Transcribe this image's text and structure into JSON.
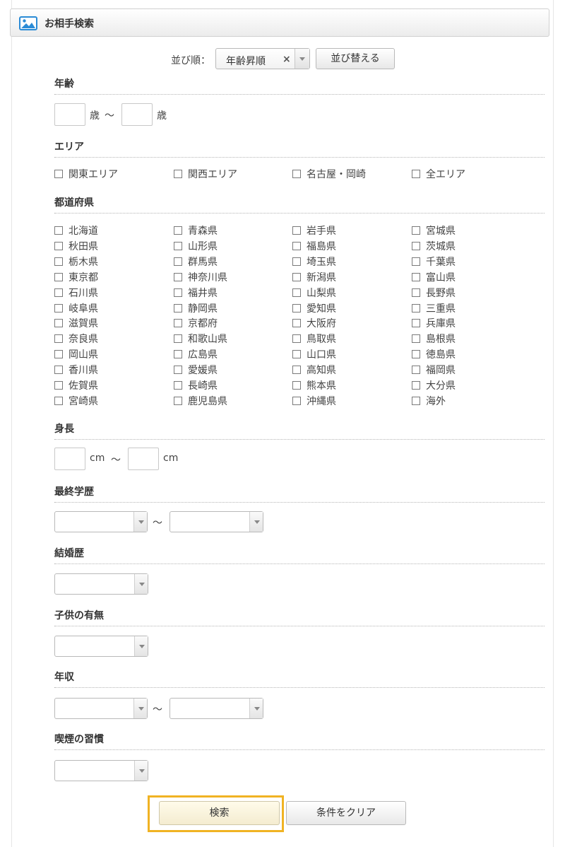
{
  "header": {
    "title": "お相手検索",
    "icon": "image-icon"
  },
  "sort": {
    "label": "並び順：",
    "selected": "年齢昇順",
    "clear": "×",
    "button": "並び替える"
  },
  "age": {
    "title": "年齢",
    "unit1": "歳",
    "tilde": "～",
    "unit2": "歳"
  },
  "area": {
    "title": "エリア",
    "items": [
      "関東エリア",
      "関西エリア",
      "名古屋・岡崎",
      "全エリア"
    ]
  },
  "prefecture": {
    "title": "都道府県",
    "items": [
      "北海道",
      "青森県",
      "岩手県",
      "宮城県",
      "秋田県",
      "山形県",
      "福島県",
      "茨城県",
      "栃木県",
      "群馬県",
      "埼玉県",
      "千葉県",
      "東京都",
      "神奈川県",
      "新潟県",
      "富山県",
      "石川県",
      "福井県",
      "山梨県",
      "長野県",
      "岐阜県",
      "静岡県",
      "愛知県",
      "三重県",
      "滋賀県",
      "京都府",
      "大阪府",
      "兵庫県",
      "奈良県",
      "和歌山県",
      "鳥取県",
      "島根県",
      "岡山県",
      "広島県",
      "山口県",
      "徳島県",
      "香川県",
      "愛媛県",
      "高知県",
      "福岡県",
      "佐賀県",
      "長崎県",
      "熊本県",
      "大分県",
      "宮崎県",
      "鹿児島県",
      "沖縄県",
      "海外"
    ]
  },
  "height": {
    "title": "身長",
    "unit1": "cm",
    "tilde": "～",
    "unit2": "cm"
  },
  "education": {
    "title": "最終学歴",
    "tilde": "～"
  },
  "marriage": {
    "title": "結婚歴"
  },
  "children": {
    "title": "子供の有無"
  },
  "income": {
    "title": "年収",
    "tilde": "～"
  },
  "smoking": {
    "title": "喫煙の習慣"
  },
  "actions": {
    "search": "検索",
    "clear": "条件をクリア"
  },
  "colors": {
    "highlight": "#f0b323",
    "icon_blue": "#2a8bd6"
  }
}
